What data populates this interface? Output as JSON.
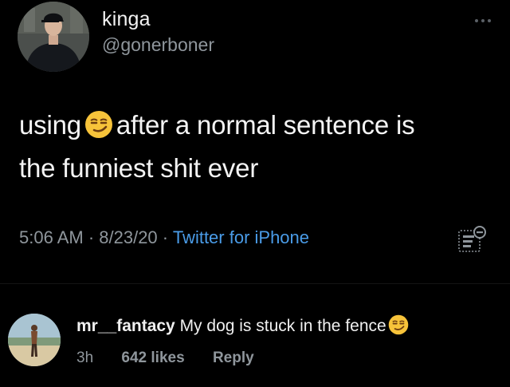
{
  "tweet": {
    "display_name": "kinga",
    "handle": "@gonerboner",
    "text_part1": "using",
    "text_part2": "after a normal sentence is",
    "text_part3": "the funniest shit ever",
    "timestamp": "5:06 AM · 8/23/20 · ",
    "source": "Twitter for iPhone",
    "icons": {
      "more": "more-options-icon",
      "analytics": "analytics-icon",
      "emoji": "smirk-emoji"
    }
  },
  "comment": {
    "username": "mr__fantacy",
    "text": " My dog is stuck in the fence",
    "age": "3h",
    "likes": "642 likes",
    "reply": "Reply"
  },
  "colors": {
    "background": "#000000",
    "text": "#f4f4f4",
    "muted": "#8f969c",
    "link": "#4a9ce8"
  }
}
